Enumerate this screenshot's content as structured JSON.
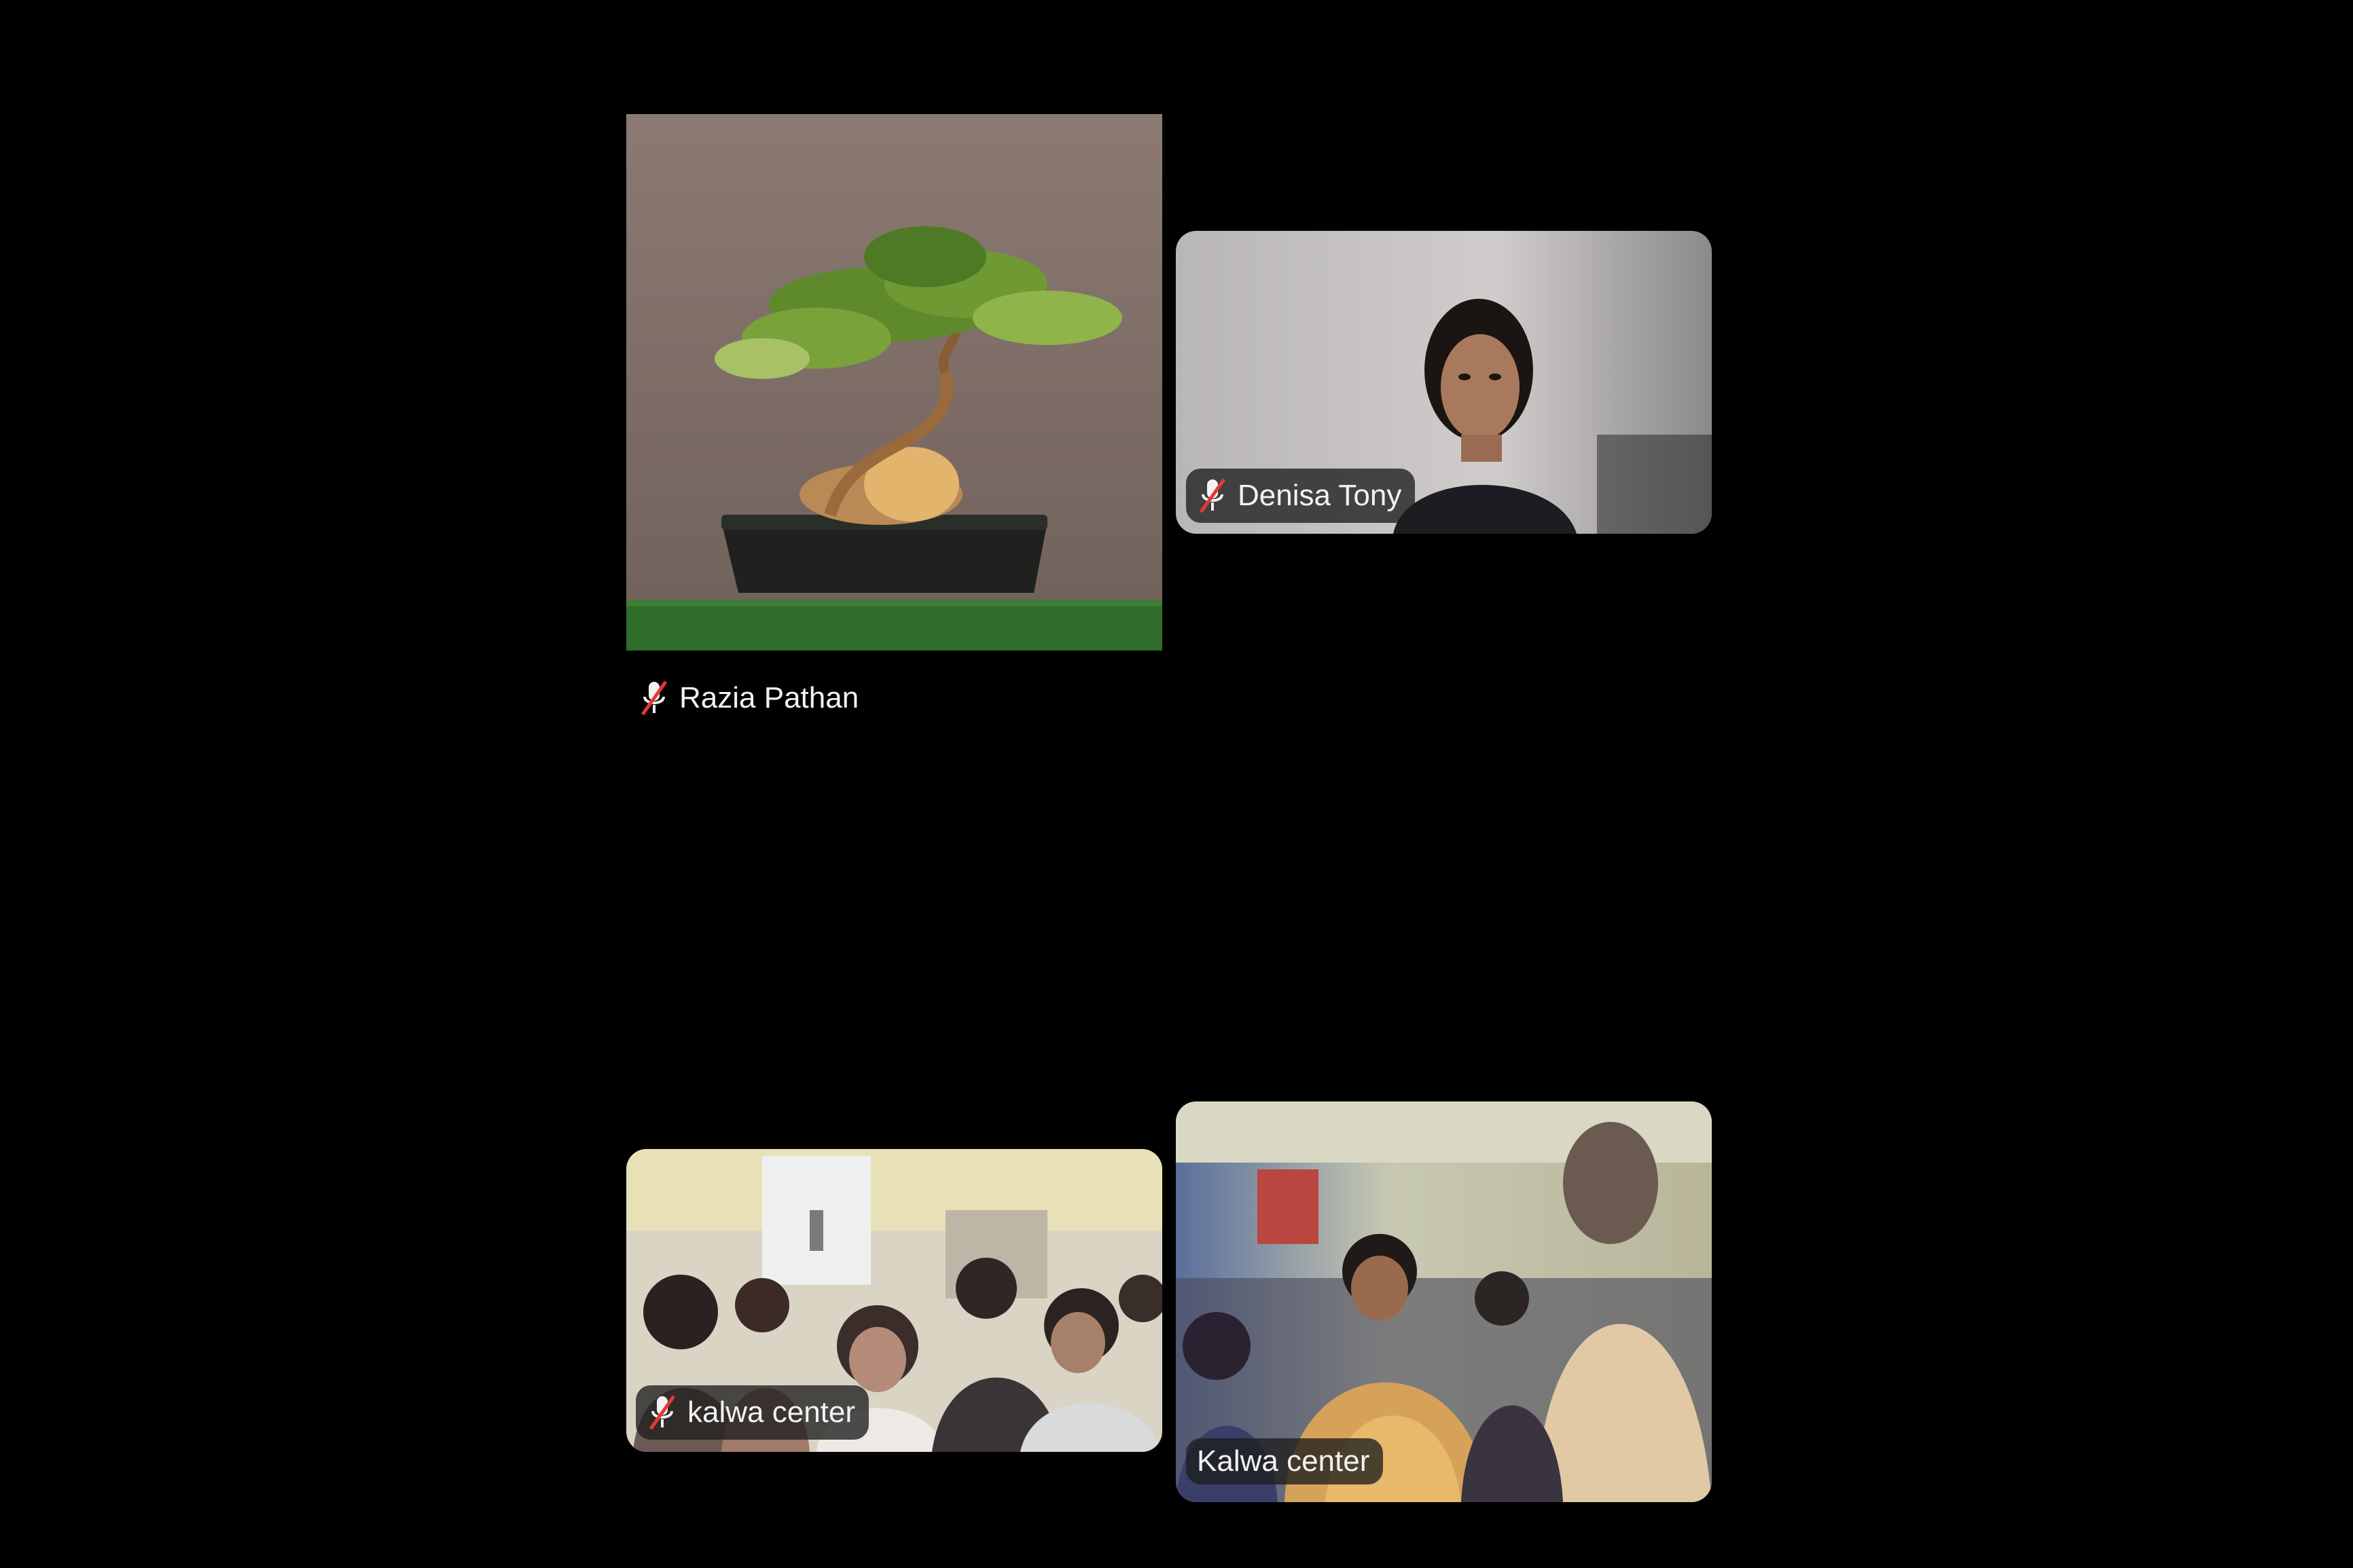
{
  "participants": [
    {
      "name": "Razia Pathan",
      "muted": true,
      "video": "bonsai-tree-image"
    },
    {
      "name": "Denisa Tony",
      "muted": true,
      "video": "webcam-person"
    },
    {
      "name": "kalwa center",
      "muted": true,
      "video": "classroom-children"
    },
    {
      "name": "Kalwa center",
      "muted": false,
      "video": "classroom-room"
    }
  ],
  "colors": {
    "background": "#000000",
    "name_tag_bg": "#1e1e1e",
    "muted_icon": "#e53935"
  },
  "icons": {
    "muted": "mic-off-icon"
  }
}
